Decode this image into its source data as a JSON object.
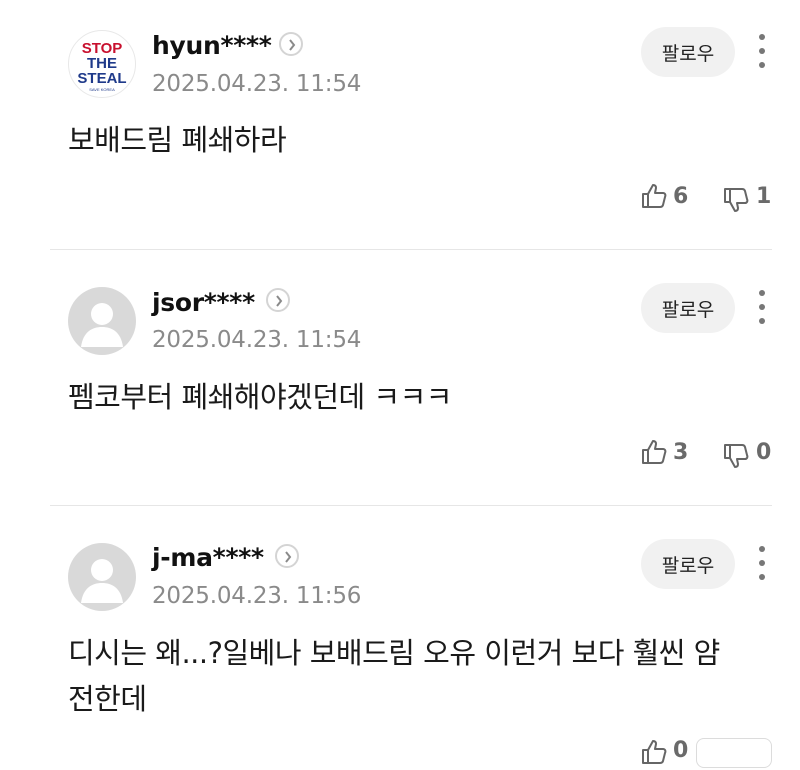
{
  "comments": [
    {
      "username": "hyun****",
      "timestamp": "2025.04.23. 11:54",
      "follow_label": "팔로우",
      "text": "보배드림 폐쇄하라",
      "likes": "6",
      "dislikes": "1",
      "avatar": {
        "type": "logo",
        "lines": [
          "STOP",
          "THE",
          "STEAL"
        ],
        "subtext": "SAVE KOREA"
      }
    },
    {
      "username": "jsor****",
      "timestamp": "2025.04.23. 11:54",
      "follow_label": "팔로우",
      "text": "펨코부터 폐쇄해야겠던데 ㅋㅋㅋ",
      "likes": "3",
      "dislikes": "0",
      "avatar": {
        "type": "default"
      }
    },
    {
      "username": "j-ma****",
      "timestamp": "2025.04.23. 11:56",
      "follow_label": "팔로우",
      "text": "디시는 왜...?일베나 보배드림 오유 이런거 보다 훨씬 얌전한데",
      "likes": "0",
      "dislikes": "",
      "avatar": {
        "type": "default"
      }
    }
  ],
  "colors": {
    "logo_red": "#c8102e",
    "logo_blue": "#1f3a8a",
    "muted": "#8a8a8a",
    "button_bg": "#f1f1f1"
  },
  "icons": [
    "profile-arrow-icon",
    "more-icon",
    "thumbs-up-icon",
    "thumbs-down-icon",
    "default-avatar-icon"
  ]
}
